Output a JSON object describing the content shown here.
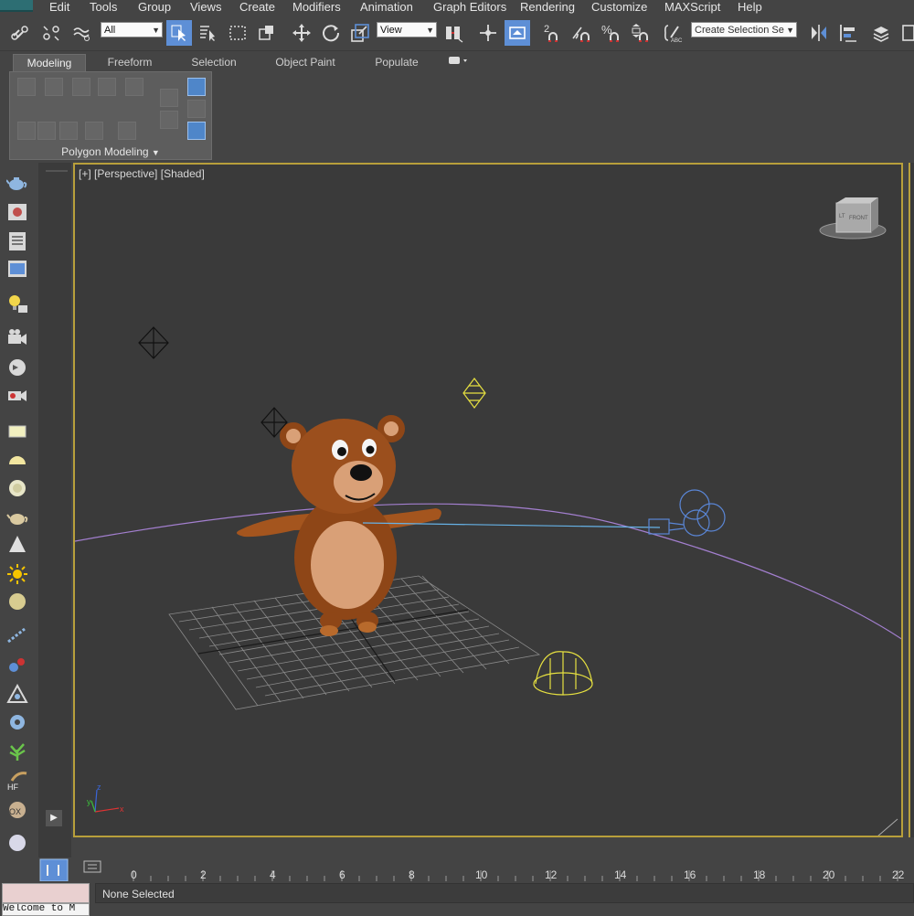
{
  "menu": {
    "items": [
      "Edit",
      "Tools",
      "Group",
      "Views",
      "Create",
      "Modifiers",
      "Animation",
      "Graph Editors",
      "Rendering",
      "Customize",
      "MAXScript",
      "Help"
    ]
  },
  "toolbar": {
    "selection_filter": "All",
    "reference_coord": "View",
    "named_selection_placeholder": "Create Selection Se",
    "snap_toggle_label": "2",
    "percent_snap_label": "%"
  },
  "ribbon": {
    "tabs": [
      "Modeling",
      "Freeform",
      "Selection",
      "Object Paint",
      "Populate"
    ],
    "panel_label": "Polygon Modeling"
  },
  "viewport": {
    "label_plus": "[+]",
    "label_view": "[Perspective]",
    "label_shading": "[Shaded]",
    "viewcube_text_left": "LT",
    "viewcube_text_front": "FRONT",
    "axis_x": "x",
    "axis_y": "y",
    "axis_z": "z"
  },
  "timeline": {
    "ticks": [
      "0",
      "2",
      "4",
      "6",
      "8",
      "10",
      "12",
      "14",
      "16",
      "18",
      "20",
      "22"
    ]
  },
  "status": {
    "selection": "None Selected",
    "listener_text": "Welcome to M"
  },
  "colors": {
    "accent": "#5e8fd6",
    "viewport_border": "#b89f3b",
    "light_gizmo": "#e6e040",
    "camera_gizmo": "#5a86d6",
    "path_spline": "#a37fcf"
  }
}
